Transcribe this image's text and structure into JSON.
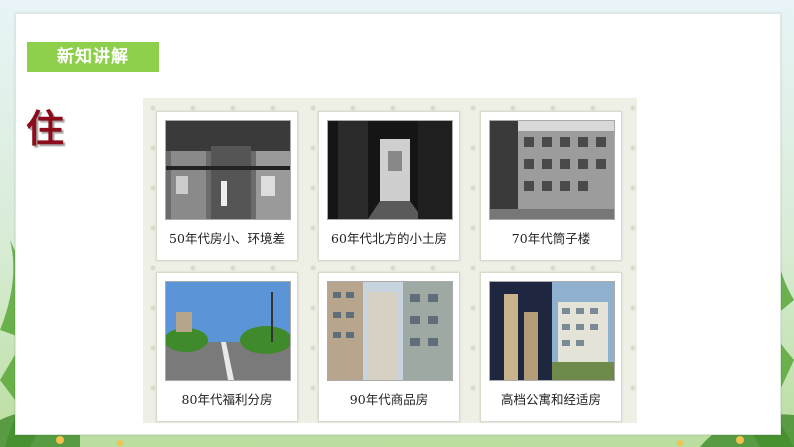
{
  "section_tag": "新知讲解",
  "topic_char": "住",
  "cards": [
    {
      "caption": "50年代房小、环境差"
    },
    {
      "caption": "60年代北方的小土房"
    },
    {
      "caption": "70年代筒子楼"
    },
    {
      "caption": "80年代福利分房"
    },
    {
      "caption": "90年代商品房"
    },
    {
      "caption": "高档公寓和经适房"
    }
  ],
  "colors": {
    "tag_green": "#8ed04c",
    "topic_red": "#8b0d1b",
    "leaf_green": "#5aa83a"
  }
}
